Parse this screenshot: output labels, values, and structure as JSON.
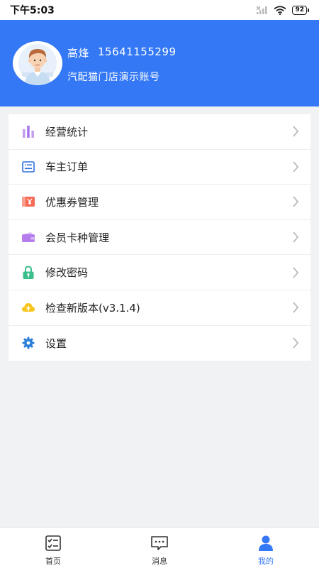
{
  "status_bar": {
    "time": "下午5:03",
    "battery": "92"
  },
  "profile": {
    "name": "高烽",
    "phone": "15641155299",
    "account": "汽配猫门店演示账号"
  },
  "menu": {
    "items": [
      {
        "label": "经营统计",
        "icon": "bar-chart-icon"
      },
      {
        "label": "车主订单",
        "icon": "order-list-icon"
      },
      {
        "label": "优惠券管理",
        "icon": "coupon-icon"
      },
      {
        "label": "会员卡种管理",
        "icon": "wallet-card-icon"
      },
      {
        "label": "修改密码",
        "icon": "lock-icon"
      },
      {
        "label": "检查新版本(v3.1.4)",
        "icon": "cloud-upload-icon"
      },
      {
        "label": "设置",
        "icon": "gear-icon"
      }
    ]
  },
  "tabbar": {
    "tabs": [
      {
        "label": "首页",
        "icon": "home-checklist-icon"
      },
      {
        "label": "消息",
        "icon": "message-bubble-icon"
      },
      {
        "label": "我的",
        "icon": "person-icon",
        "active": true
      }
    ]
  },
  "colors": {
    "accent": "#3478f6",
    "background": "#f1f2f4"
  }
}
